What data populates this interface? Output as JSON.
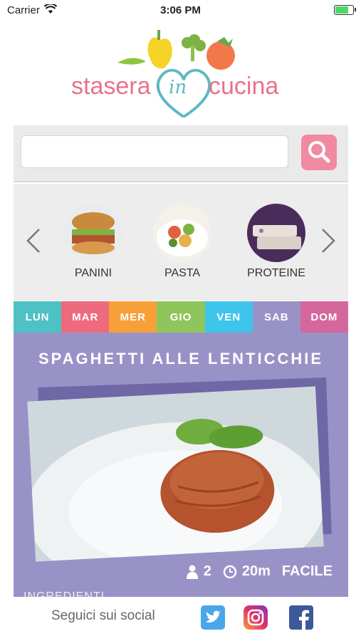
{
  "status_bar": {
    "carrier": "Carrier",
    "time": "3:06 PM"
  },
  "logo": {
    "part1": "stasera",
    "part2": "in",
    "part3": "cucina"
  },
  "search": {
    "placeholder": ""
  },
  "categories": [
    {
      "label": "PANINI"
    },
    {
      "label": "PASTA"
    },
    {
      "label": "PROTEINE"
    }
  ],
  "days": [
    {
      "label": "LUN",
      "color": "#4dc1c4"
    },
    {
      "label": "MAR",
      "color": "#ee6a7e"
    },
    {
      "label": "MER",
      "color": "#f7a03a"
    },
    {
      "label": "GIO",
      "color": "#8fc65c"
    },
    {
      "label": "VEN",
      "color": "#3ec5ec"
    },
    {
      "label": "SAB",
      "color": "#9992c7"
    },
    {
      "label": "DOM",
      "color": "#d5679c"
    }
  ],
  "selected_day": "SAB",
  "recipe": {
    "title": "SPAGHETTI ALLE LENTICCHIE",
    "servings": "2",
    "time": "20m",
    "difficulty": "FACILE",
    "ingredients_heading": "INGREDIENTI"
  },
  "footer": {
    "follow_label": "Seguici sui social"
  },
  "social_icons": [
    "twitter-icon",
    "instagram-icon",
    "facebook-icon"
  ]
}
